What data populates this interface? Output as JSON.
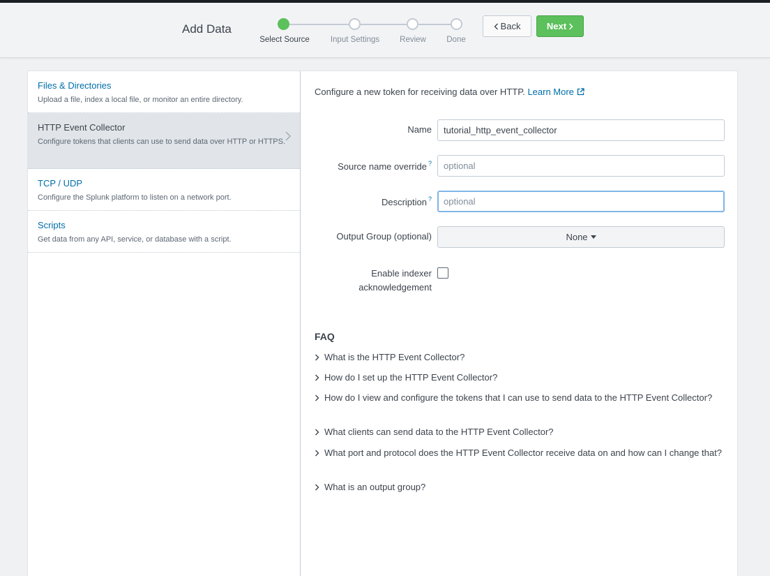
{
  "header": {
    "title": "Add Data",
    "back_label": "Back",
    "next_label": "Next"
  },
  "steps": [
    {
      "label": "Select Source",
      "active": true
    },
    {
      "label": "Input Settings",
      "active": false
    },
    {
      "label": "Review",
      "active": false
    },
    {
      "label": "Done",
      "active": false
    }
  ],
  "sources": [
    {
      "title": "Files & Directories",
      "desc": "Upload a file, index a local file, or monitor an entire directory."
    },
    {
      "title": "HTTP Event Collector",
      "desc": "Configure tokens that clients can use to send data over HTTP or HTTPS."
    },
    {
      "title": "TCP / UDP",
      "desc": "Configure the Splunk platform to listen on a network port."
    },
    {
      "title": "Scripts",
      "desc": "Get data from any API, service, or database with a script."
    }
  ],
  "form": {
    "intro": "Configure a new token for receiving data over HTTP.",
    "learn_more": "Learn More",
    "name_label": "Name",
    "name_value": "tutorial_http_event_collector",
    "source_label": "Source name override",
    "source_placeholder": "optional",
    "desc_label": "Description",
    "desc_placeholder": "optional",
    "help_mark": "?",
    "output_label": "Output Group (optional)",
    "output_value": "None",
    "ack_label_1": "Enable indexer",
    "ack_label_2": "acknowledgement"
  },
  "faq": {
    "title": "FAQ",
    "items": [
      "What is the HTTP Event Collector?",
      "How do I set up the HTTP Event Collector?",
      "How do I view and configure the tokens that I can use to send data to the HTTP Event Collector?",
      "What clients can send data to the HTTP Event Collector?",
      "What port and protocol does the HTTP Event Collector receive data on and how can I change that?",
      "What is an output group?"
    ]
  },
  "colors": {
    "accent_green": "#5cc05c",
    "link_blue": "#006eaa",
    "focus_blue": "#7fb6e6"
  }
}
